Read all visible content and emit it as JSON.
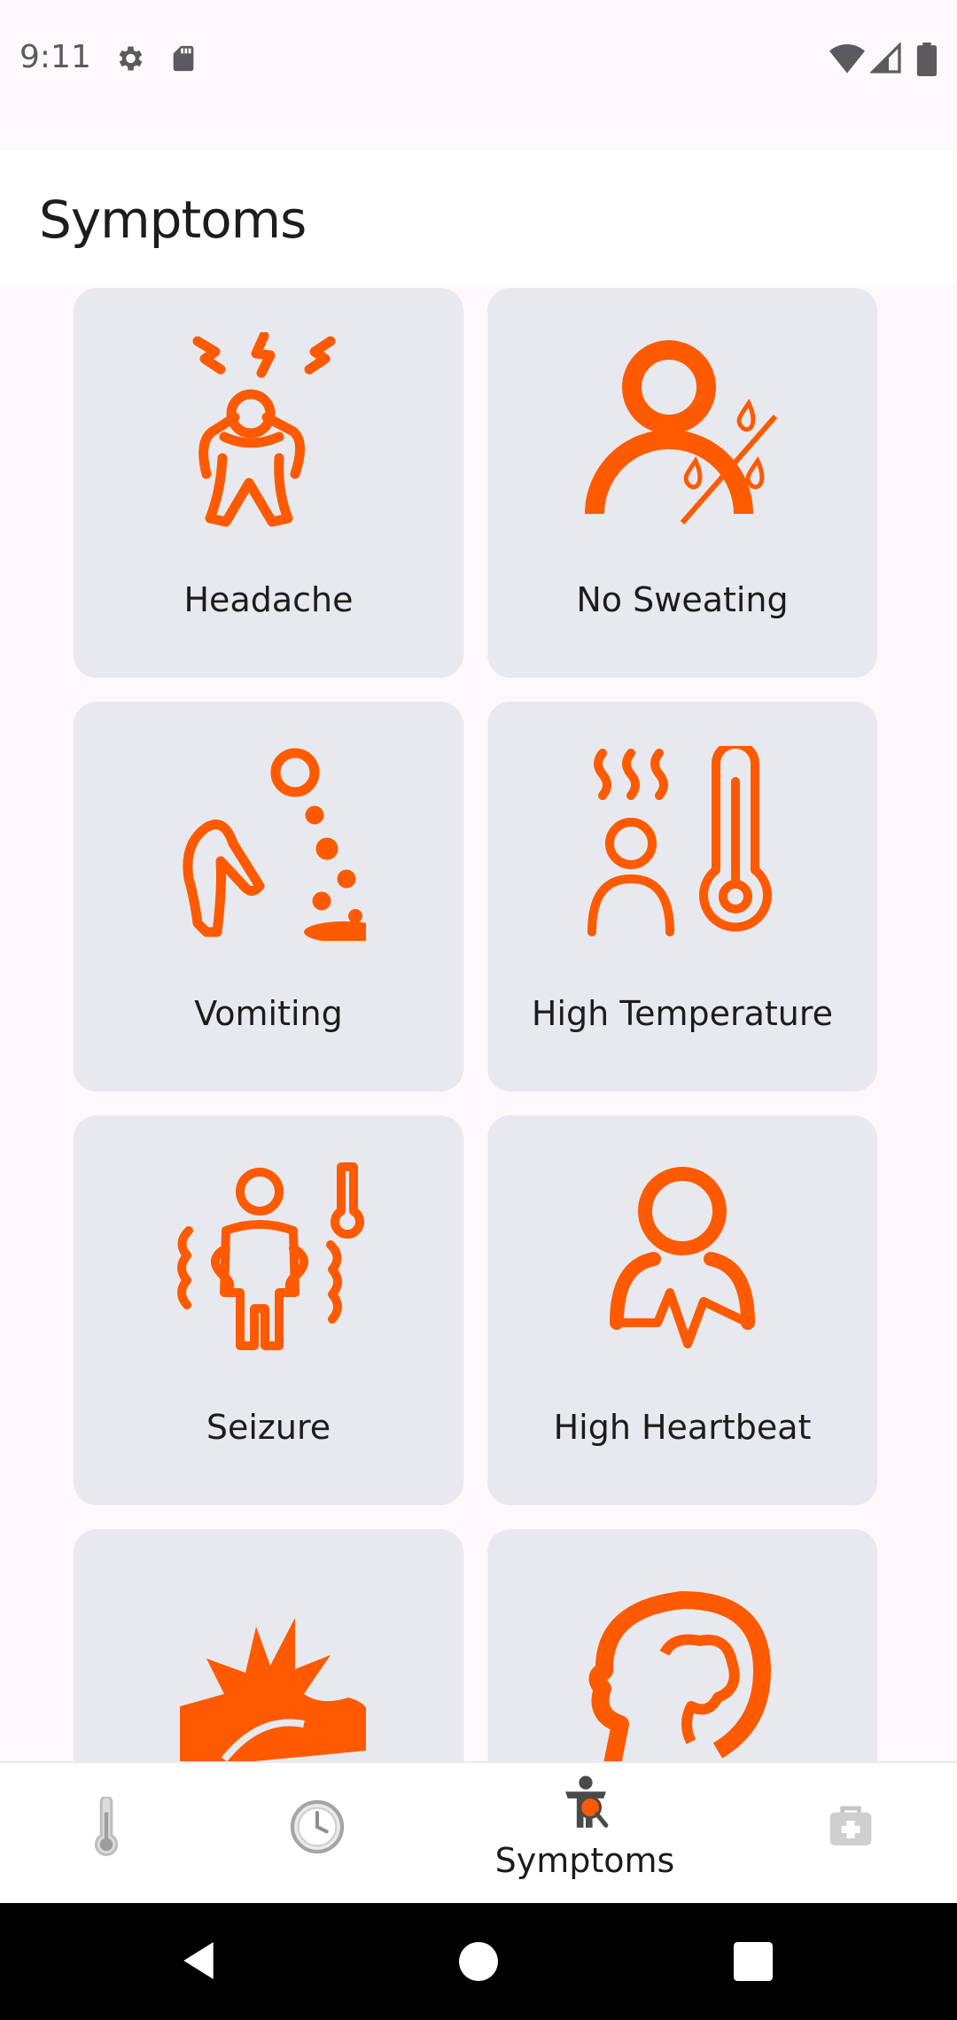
{
  "status_bar": {
    "time": "9:11",
    "icons": [
      "gear-icon",
      "sd-card-icon",
      "wifi-icon",
      "signal-icon",
      "battery-icon"
    ]
  },
  "page": {
    "title": "Symptoms"
  },
  "accent_color": "#ff5a00",
  "symptoms": [
    {
      "label": "Headache",
      "icon": "headache-icon"
    },
    {
      "label": "No Sweating",
      "icon": "no-sweating-icon"
    },
    {
      "label": "Vomiting",
      "icon": "vomiting-icon"
    },
    {
      "label": "High Temperature",
      "icon": "high-temperature-icon"
    },
    {
      "label": "Seizure",
      "icon": "seizure-icon"
    },
    {
      "label": "High Heartbeat",
      "icon": "high-heartbeat-icon"
    },
    {
      "label": "",
      "icon": "pain-burst-icon"
    },
    {
      "label": "",
      "icon": "brain-icon"
    }
  ],
  "bottom_nav": {
    "items": [
      {
        "label": "",
        "icon": "thermometer-icon"
      },
      {
        "label": "",
        "icon": "clock-icon"
      },
      {
        "label": "Symptoms",
        "icon": "symptoms-icon",
        "active": true
      },
      {
        "label": "",
        "icon": "first-aid-icon"
      }
    ]
  }
}
